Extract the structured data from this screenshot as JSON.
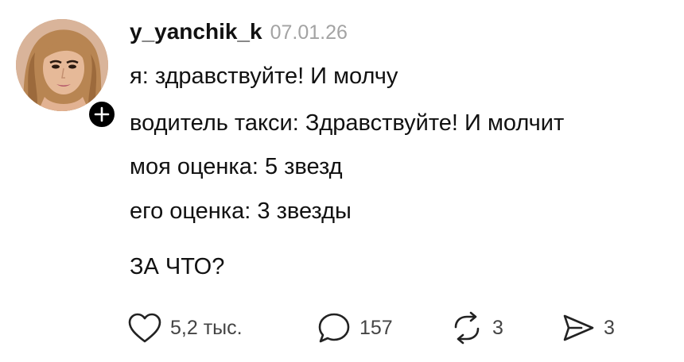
{
  "post": {
    "author": {
      "username": "y_yanchik_k",
      "date": "07.01.26"
    },
    "lines": [
      "я: здравствуйте! И молчу",
      "водитель такси: Здравствуйте! И молчит",
      "моя оценка: 5 звезд",
      "его оценка: 3 звезды",
      "ЗА ЧТО?"
    ],
    "actions": {
      "likes": "5,2 тыс.",
      "comments": "157",
      "reposts": "3",
      "shares": "3"
    }
  },
  "colors": {
    "text": "#111111",
    "muted": "#a3a3a3",
    "badge": "#000000"
  },
  "icons": [
    "plus-icon",
    "heart-icon",
    "comment-icon",
    "repost-icon",
    "share-icon"
  ]
}
